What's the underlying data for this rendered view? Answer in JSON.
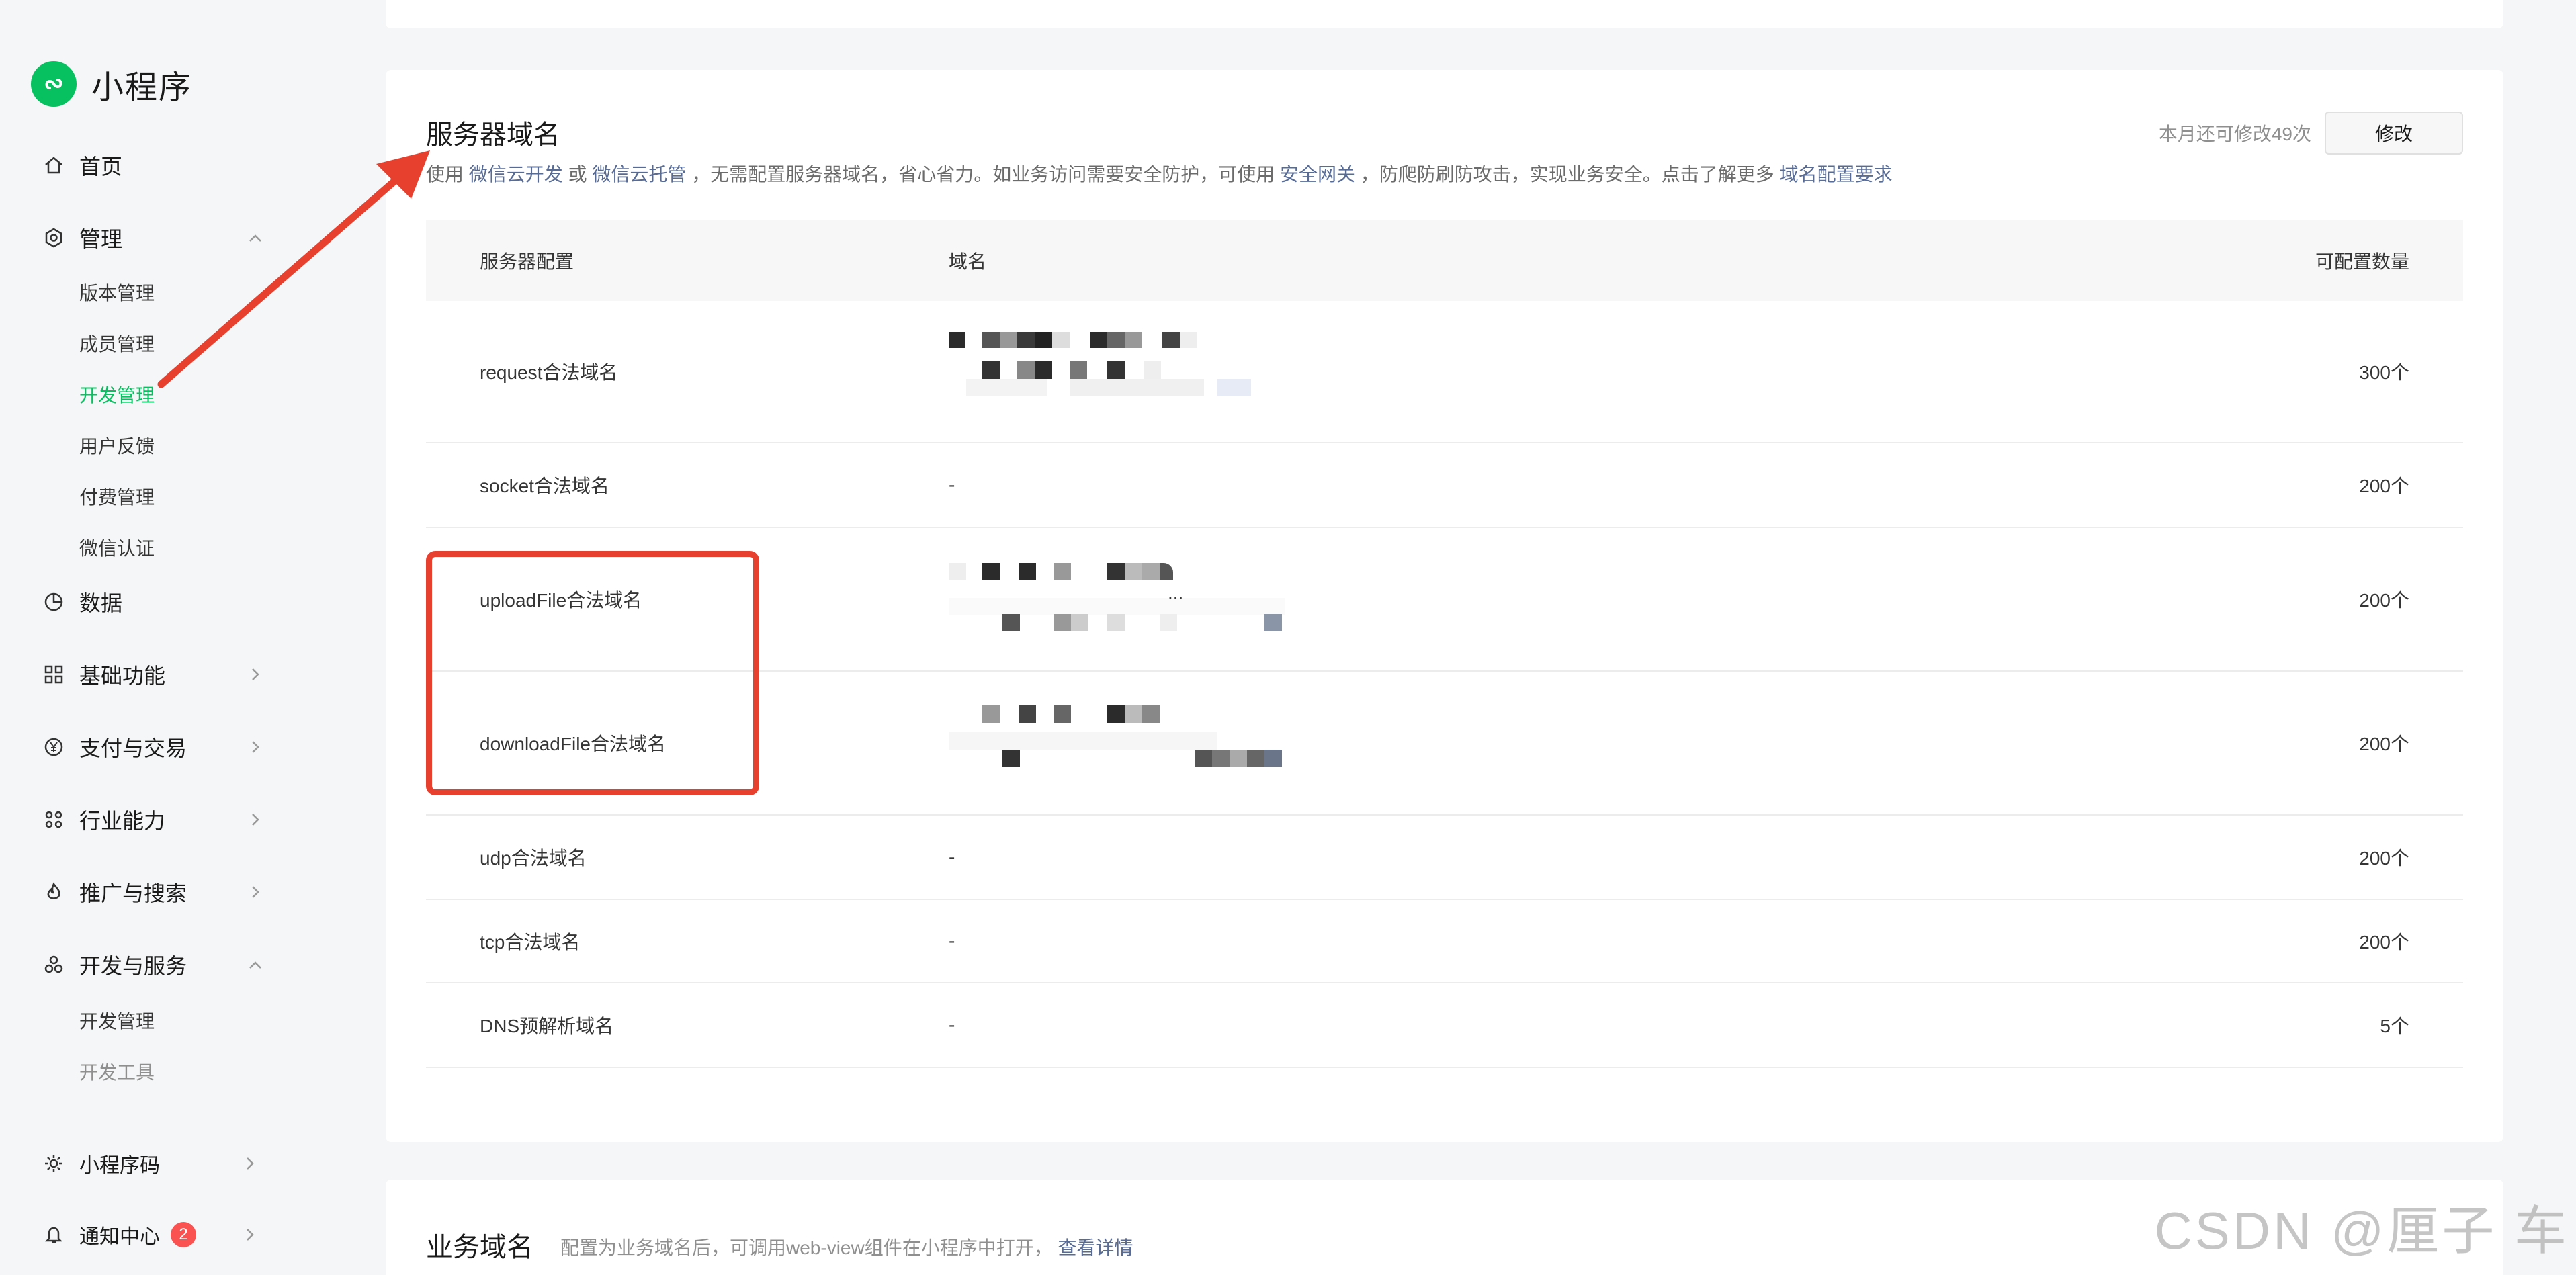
{
  "sidebar": {
    "app_name": "小程序",
    "items": {
      "home": "首页",
      "manage": "管理",
      "manage_sub": [
        "版本管理",
        "成员管理",
        "开发管理",
        "用户反馈",
        "付费管理",
        "微信认证"
      ],
      "data": "数据",
      "basic": "基础功能",
      "pay": "支付与交易",
      "industry": "行业能力",
      "promo": "推广与搜索",
      "devsvc": "开发与服务",
      "devsvc_sub": [
        "开发管理",
        "开发工具"
      ],
      "qrcode": "小程序码",
      "notice": "通知中心",
      "notice_badge": "2"
    }
  },
  "server_domain": {
    "title": "服务器域名",
    "desc_prefix": "使用",
    "link_cloud_dev": "微信云开发",
    "desc_or": "或",
    "link_cloud_host": "微信云托管",
    "desc_mid": "，无需配置服务器域名，省心省力。如业务访问需要安全防护，可使用",
    "link_gateway": "安全网关",
    "desc_mid2": "，防爬防刷防攻击，实现业务安全。点击了解更多",
    "link_req": "域名配置要求",
    "quota_text": "本月还可修改49次",
    "edit_label": "修改",
    "columns": [
      "服务器配置",
      "域名",
      "可配置数量"
    ],
    "rows": [
      {
        "name": "request合法域名",
        "domain": "",
        "count": "300个"
      },
      {
        "name": "socket合法域名",
        "domain": "-",
        "count": "200个"
      },
      {
        "name": "uploadFile合法域名",
        "domain": "...",
        "count": "200个"
      },
      {
        "name": "downloadFile合法域名",
        "domain": "",
        "count": "200个"
      },
      {
        "name": "udp合法域名",
        "domain": "-",
        "count": "200个"
      },
      {
        "name": "tcp合法域名",
        "domain": "-",
        "count": "200个"
      },
      {
        "name": "DNS预解析域名",
        "domain": "-",
        "count": "5个"
      }
    ]
  },
  "business_domain": {
    "title": "业务域名",
    "desc": "配置为业务域名后，可调用web-view组件在小程序中打开，",
    "link": "查看详情"
  },
  "watermark": "CSDN @厘子 车",
  "colors": {
    "accent": "#07c160",
    "link": "#576b95",
    "annotation": "#e8402f",
    "badge": "#fa5151"
  }
}
